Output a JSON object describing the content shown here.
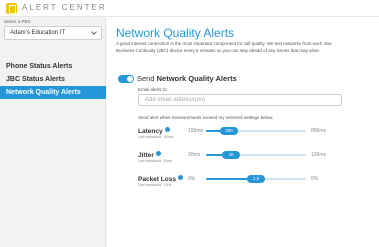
{
  "app": {
    "title": "ALERT CENTER"
  },
  "sidebar": {
    "pbx_label": "Select a PBX",
    "pbx_value": "Adam's Education IT",
    "items": [
      {
        "label": "Phone Status Alerts",
        "active": false
      },
      {
        "label": "JBC Status Alerts",
        "active": false
      },
      {
        "label": "Network Quality Alerts",
        "active": true
      }
    ]
  },
  "main": {
    "title": "Network Quality Alerts",
    "description": "A good internet connection is the most important component for call quality. We test networks from each Jive Business Continuity (JBC) device every 5 minutes so you can stay ahead of any issues that may arise.",
    "send_prefix": "Send ",
    "send_bold": "Network Quality Alerts",
    "send_enabled": true,
    "email_label": "Email alerts to:",
    "email_placeholder": "Add email address(es)",
    "threshold_label": "Send alert when measurements exceed my selected settings below.",
    "metrics": [
      {
        "name": "Latency",
        "sub": "Last measured: 150ms",
        "min": "150ms",
        "max": "800ms",
        "value": "300",
        "fraction": 0.23
      },
      {
        "name": "Jitter",
        "sub": "Last measured: 20ms",
        "min": "20ms",
        "max": "100ms",
        "value": "40",
        "fraction": 0.25
      },
      {
        "name": "Packet Loss",
        "sub": "Last measured: 1.5%",
        "min": "0%",
        "max": "5%",
        "value": "2.5",
        "fraction": 0.5
      }
    ]
  },
  "colors": {
    "accent": "#2596d8",
    "logo": "#f2c500"
  }
}
